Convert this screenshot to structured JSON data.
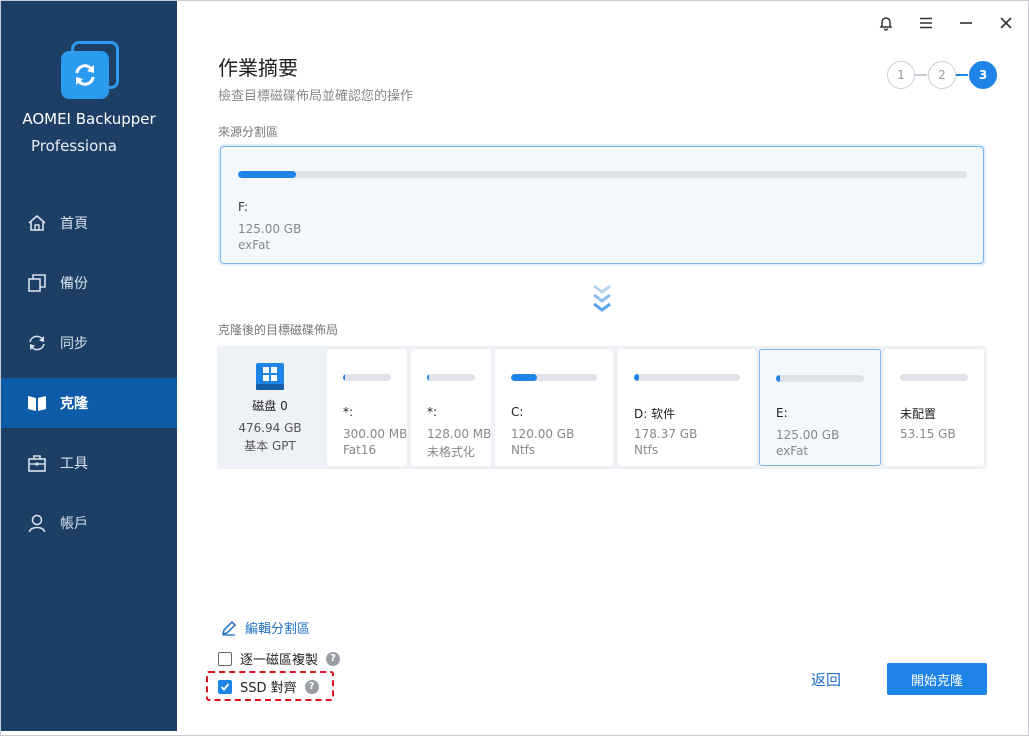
{
  "app": {
    "name": "AOMEI Backupper",
    "edition": "Professiona"
  },
  "sidebar": {
    "items": [
      {
        "label": "首頁",
        "icon": "home-icon"
      },
      {
        "label": "備份",
        "icon": "backup-icon"
      },
      {
        "label": "同步",
        "icon": "sync-icon"
      },
      {
        "label": "克隆",
        "icon": "clone-icon",
        "active": true
      },
      {
        "label": "工具",
        "icon": "toolbox-icon"
      },
      {
        "label": "帳戶",
        "icon": "user-icon"
      }
    ]
  },
  "window_controls": [
    "bell-icon",
    "menu-icon",
    "minimize-icon",
    "close-icon"
  ],
  "header": {
    "title": "作業摘要",
    "subtitle": "檢查目標磁碟佈局並確認您的操作"
  },
  "steps": {
    "labels": [
      "1",
      "2",
      "3"
    ],
    "current": 3
  },
  "source": {
    "label": "來源分割區",
    "partition": {
      "letter": "F:",
      "size": "125.00 GB",
      "fs": "exFat",
      "used_fraction": 0.08
    }
  },
  "target": {
    "label": "克隆後的目標磁碟佈局",
    "disk": {
      "name": "磁盘 0",
      "size": "476.94 GB",
      "type": "基本 GPT"
    },
    "partitions": [
      {
        "letter": "*:",
        "size": "300.00 MB",
        "fs": "Fat16",
        "used_fraction": 0.05
      },
      {
        "letter": "*:",
        "size": "128.00 MB",
        "fs": "未格式化",
        "used_fraction": 0.05
      },
      {
        "letter": "C:",
        "size": "120.00 GB",
        "fs": "Ntfs",
        "used_fraction": 0.3
      },
      {
        "letter": "D: 软件",
        "size": "178.37 GB",
        "fs": "Ntfs",
        "used_fraction": 0.05
      },
      {
        "letter": "E:",
        "size": "125.00 GB",
        "fs": "exFat",
        "used_fraction": 0.05,
        "selected": true
      },
      {
        "letter": "未配置",
        "size": "53.15 GB",
        "fs": "",
        "used_fraction": 0
      }
    ]
  },
  "options": {
    "edit_partitions": "編輯分割區",
    "sector_by_sector": {
      "label": "逐一磁區複製",
      "checked": false
    },
    "ssd_align": {
      "label": "SSD 對齊",
      "checked": true
    }
  },
  "buttons": {
    "back": "返回",
    "start": "開始克隆"
  },
  "colors": {
    "sidebar": "#1d3f66",
    "accent": "#1f84e7",
    "highlight": "#d9141b"
  }
}
